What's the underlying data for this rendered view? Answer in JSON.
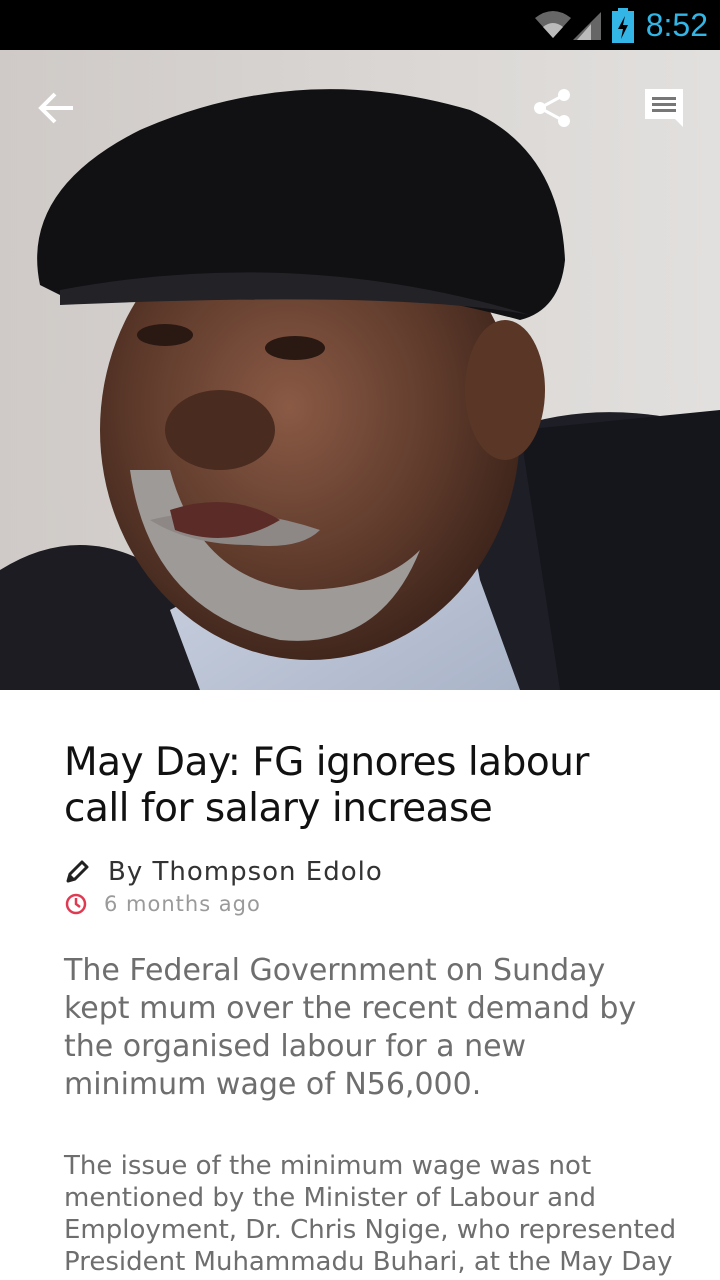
{
  "status_bar": {
    "time": "8:52",
    "icons": [
      "wifi-icon",
      "signal-icon",
      "battery-charging-icon"
    ],
    "accent_color": "#33b5e5"
  },
  "toolbar": {
    "back_icon": "arrow-left-icon",
    "share_icon": "share-icon",
    "comments_icon": "comment-icon"
  },
  "article": {
    "title": "May Day: FG ignores labour call for salary increase",
    "author": "By Thompson Edolo",
    "author_icon": "pencil-icon",
    "published": "6 months ago",
    "time_icon": "clock-icon",
    "time_icon_color": "#e03a52",
    "lead": "The Federal Government on Sunday kept mum over the recent demand by the organised labour for a new minimum wage of N56,000.",
    "body": "The issue of the minimum wage was not mentioned by the Minister of Labour and Employment, Dr. Chris Ngige, who represented President Muhammadu Buhari, at the May Day"
  }
}
